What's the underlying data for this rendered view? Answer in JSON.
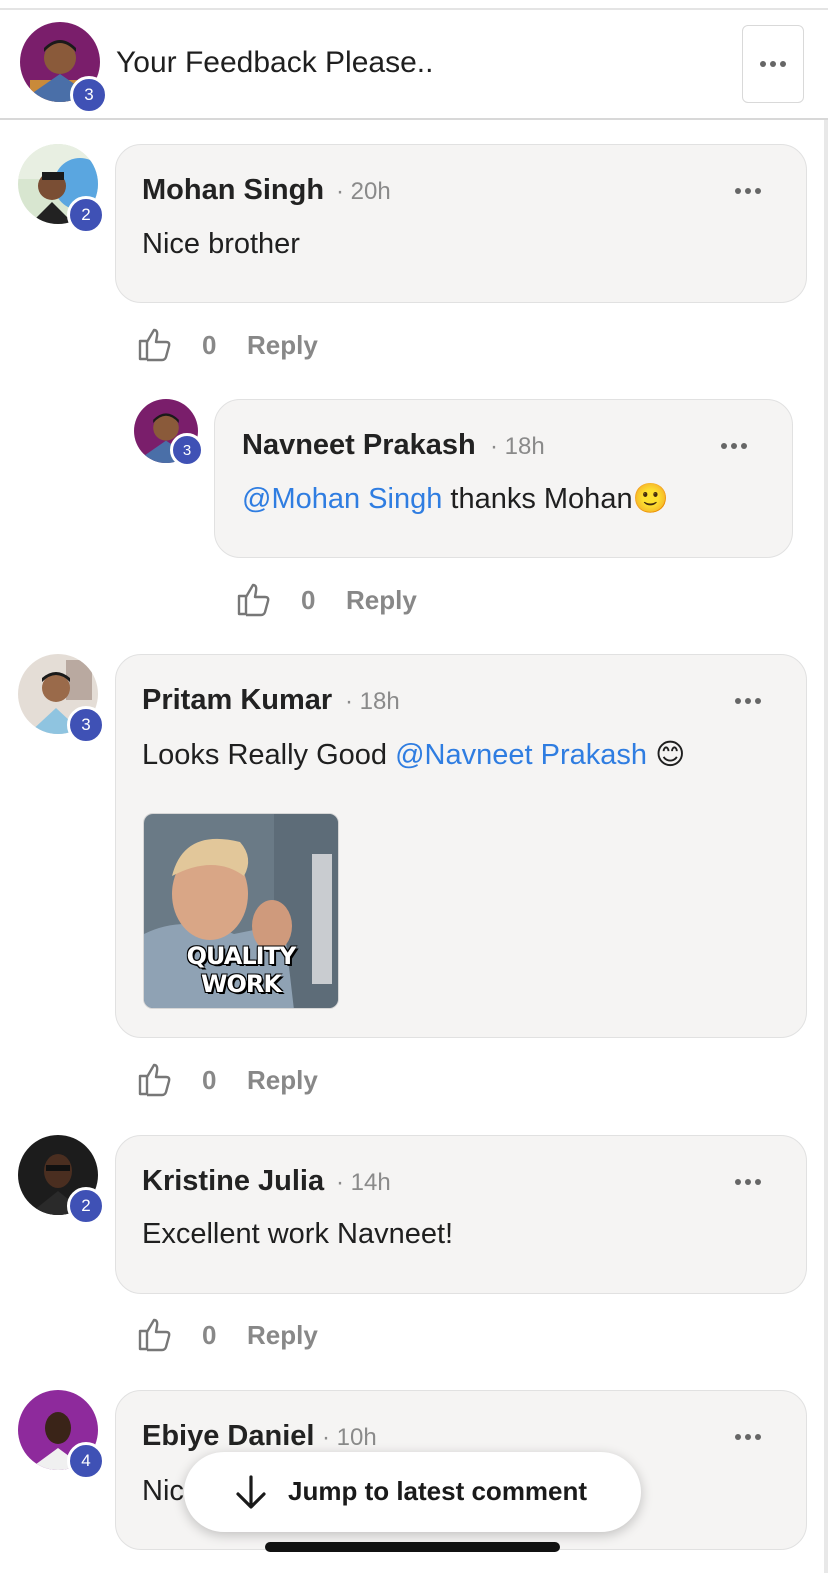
{
  "header": {
    "title": "Your Feedback Please..",
    "avatar_badge": "3",
    "menu_icon": "more-horizontal-icon"
  },
  "comments": [
    {
      "author": "Mohan Singh",
      "time": "· 20h",
      "badge": "2",
      "text": "Nice brother",
      "likes": "0",
      "reply_label": "Reply"
    },
    {
      "author": "Navneet Prakash",
      "time": "· 18h",
      "badge": "3",
      "mention": "@Mohan Singh",
      "text": " thanks Mohan",
      "emoji": "🙂",
      "likes": "0",
      "reply_label": "Reply"
    },
    {
      "author": "Pritam Kumar",
      "time": "· 18h",
      "badge": "3",
      "text": "Looks Really Good ",
      "mention": "@Navneet Prakash",
      "emoji": "😊",
      "gif_caption": "QUALITY WORK",
      "likes": "0",
      "reply_label": "Reply"
    },
    {
      "author": "Kristine Julia",
      "time": "· 14h",
      "badge": "2",
      "text": "Excellent work Navneet!",
      "likes": "0",
      "reply_label": "Reply"
    },
    {
      "author": "Ebiye Daniel",
      "time": "· 10h",
      "badge": "4",
      "text": "Nic"
    }
  ],
  "jump_button": {
    "label": "Jump to latest comment",
    "icon": "arrow-down-icon"
  },
  "colors": {
    "badge": "#3f51b5",
    "mention": "#2f7de1",
    "bubble": "#f5f4f3"
  }
}
